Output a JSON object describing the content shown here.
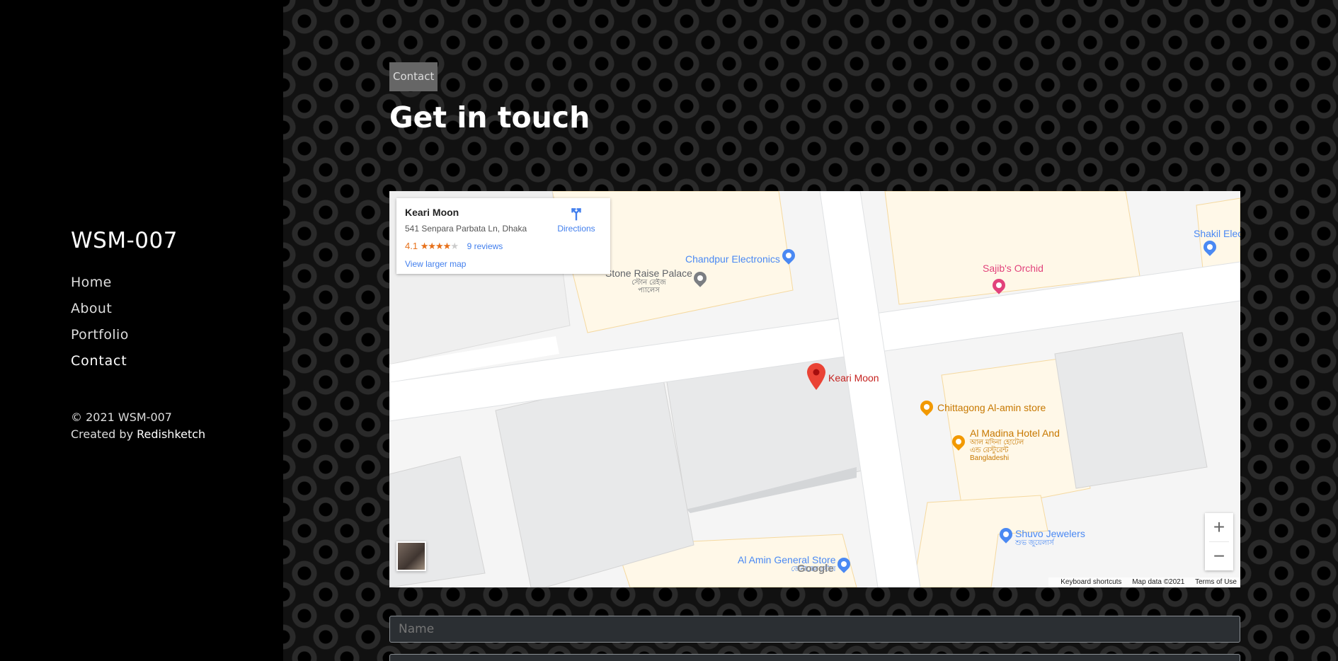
{
  "sidebar": {
    "brand": "WSM-007",
    "nav": [
      {
        "label": "Home",
        "active": false
      },
      {
        "label": "About",
        "active": false
      },
      {
        "label": "Portfolio",
        "active": false
      },
      {
        "label": "Contact",
        "active": true
      }
    ],
    "copyright": "© 2021 WSM-007",
    "created_by_prefix": "Created by",
    "author": "Redishketch"
  },
  "main": {
    "badge": "Contact",
    "title": "Get in touch"
  },
  "map": {
    "card": {
      "name": "Keari Moon",
      "address": "541 Senpara Parbata Ln, Dhaka",
      "rating": "4.1",
      "stars_filled": "★★★★",
      "stars_empty": "★",
      "reviews": "9 reviews",
      "larger_map": "View larger map",
      "directions": "Directions"
    },
    "places": {
      "chandpur": "Chandpur Electronics",
      "stone_raise": "Stone Raise Palace",
      "stone_raise_sub1": "স্টোন রেইজ",
      "stone_raise_sub2": "প্যালেস",
      "sajib": "Sajib's Orchid",
      "shakil": "Shakil Elec",
      "keari": "Keari Moon",
      "chittagong": "Chittagong Al-amin store",
      "al_madina": "Al Madina Hotel And",
      "al_madina_sub1": "আল মদিনা হোটেল",
      "al_madina_sub2": "এন্ড রেস্টুরেন্ট",
      "al_madina_sub3": "Bangladeshi",
      "shuvo": "Shuvo Jewelers",
      "shuvo_sub": "শুভ জুয়েলার্স",
      "al_amin": "Al Amin General Store",
      "al_amin_sub": "জেনারেল স্টোর"
    },
    "zoom_in": "+",
    "zoom_out": "−",
    "google": "Google",
    "attribution": {
      "shortcuts": "Keyboard shortcuts",
      "data": "Map data ©2021",
      "terms": "Terms of Use"
    },
    "colors": {
      "blue_poi": "#4a89f3",
      "pink_poi": "#e2427b",
      "orange_poi": "#f29900",
      "red_pin": "#ea4335",
      "gray_poi": "#7b7e82"
    }
  },
  "form": {
    "name_placeholder": "Name"
  }
}
